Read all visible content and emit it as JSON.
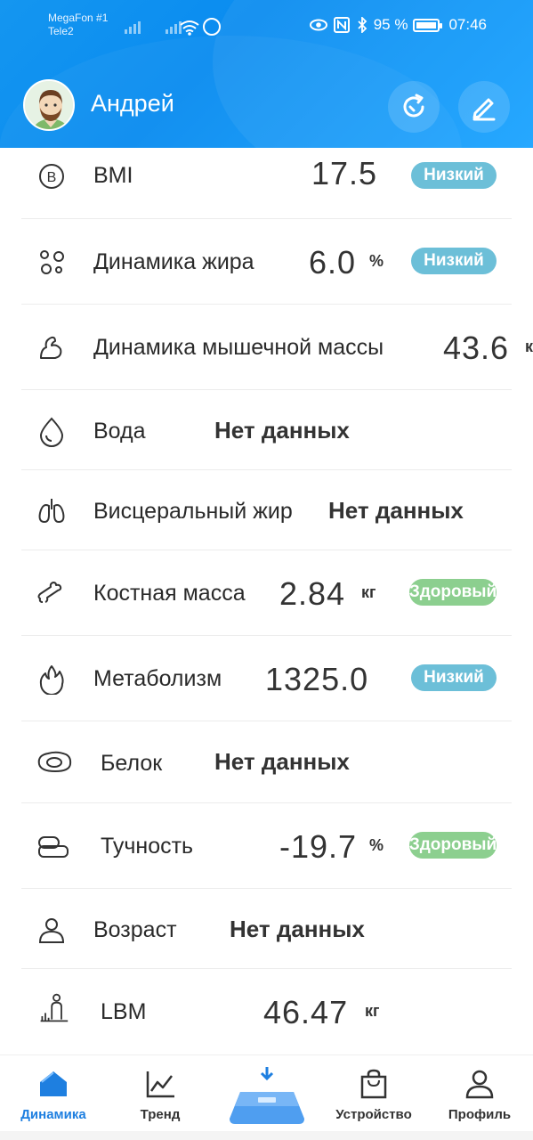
{
  "status_bar": {
    "carrier1": "MegaFon #1",
    "carrier2": "Tele2",
    "battery": "95 %",
    "time": "07:46"
  },
  "header": {
    "username": "Андрей"
  },
  "metrics": [
    {
      "label": "BMI",
      "value": "17.5",
      "unit": "",
      "badge": "Низкий",
      "badge_type": "low",
      "icon": "bmi-icon"
    },
    {
      "label": "Динамика жира",
      "value": "6.0",
      "unit": "%",
      "badge": "Низкий",
      "badge_type": "low",
      "icon": "fat-icon"
    },
    {
      "label": "Динамика мышечной массы",
      "value": "43.6",
      "unit": "к",
      "badge": "",
      "badge_type": "",
      "icon": "muscle-icon"
    },
    {
      "label": "Вода",
      "value": "Нет данных",
      "unit": "",
      "badge": "",
      "badge_type": "",
      "icon": "water-drop-icon"
    },
    {
      "label": "Висцеральный жир",
      "value": "Нет данных",
      "unit": "",
      "badge": "",
      "badge_type": "",
      "icon": "lungs-icon"
    },
    {
      "label": "Костная масса",
      "value": "2.84",
      "unit": "кг",
      "badge": "Здоровый",
      "badge_type": "healthy",
      "icon": "bone-icon"
    },
    {
      "label": "Метаболизм",
      "value": "1325.0",
      "unit": "",
      "badge": "Низкий",
      "badge_type": "low",
      "icon": "flame-icon"
    },
    {
      "label": "Белок",
      "value": "Нет данных",
      "unit": "",
      "badge": "",
      "badge_type": "",
      "icon": "protein-icon"
    },
    {
      "label": "Тучность",
      "value": "-19.7",
      "unit": "%",
      "badge": "Здоровый",
      "badge_type": "healthy",
      "icon": "obesity-icon"
    },
    {
      "label": "Возраст",
      "value": "Нет данных",
      "unit": "",
      "badge": "",
      "badge_type": "",
      "icon": "person-icon"
    },
    {
      "label": "LBM",
      "value": "46.47",
      "unit": "кг",
      "badge": "",
      "badge_type": "",
      "icon": "lbm-icon"
    }
  ],
  "nav": [
    {
      "label": "Динамика",
      "icon": "home-icon",
      "active": true
    },
    {
      "label": "Тренд",
      "icon": "trend-chart-icon",
      "active": false
    },
    {
      "label": "Устройство",
      "icon": "shopping-bag-icon",
      "active": false
    },
    {
      "label": "Профиль",
      "icon": "profile-icon",
      "active": false
    }
  ],
  "colors": {
    "header": "#0a8cf0",
    "badge_low": "#6cbfd8",
    "badge_healthy": "#8ccf8f",
    "nav_active": "#1e7fe0"
  }
}
